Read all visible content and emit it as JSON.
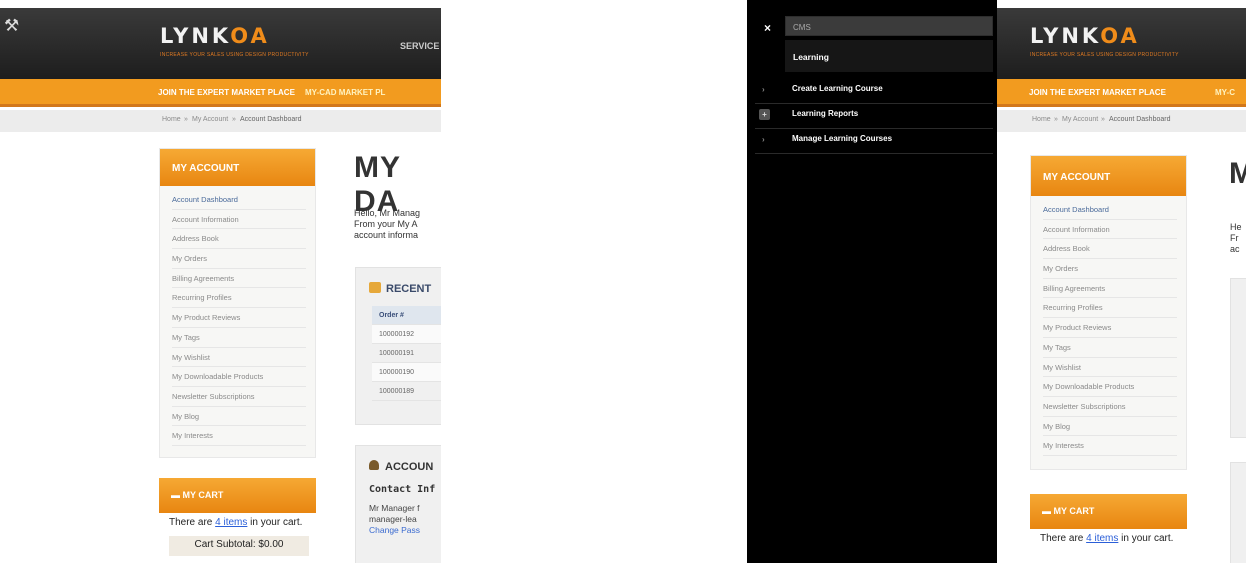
{
  "site": {
    "logo_main": "LYNK",
    "logo_accent": "OA",
    "tagline": "INCREASE YOUR SALES USING DESIGN PRODUCTIVITY",
    "topnav_item": "SERVICE",
    "orange_links": [
      "JOIN THE EXPERT MARKET PLACE",
      "MY-CAD MARKET PL"
    ],
    "orange_links_alt": [
      "JOIN THE EXPERT MARKET PLACE",
      "MY-C"
    ],
    "breadcrumb": {
      "home": "Home",
      "sep": "»",
      "account": "My Account",
      "current": "Account Dashboard"
    }
  },
  "account_nav": {
    "title": "MY ACCOUNT",
    "items": [
      "Account Dashboard",
      "Account Information",
      "Address Book",
      "My Orders",
      "Billing Agreements",
      "Recurring Profiles",
      "My Product Reviews",
      "My Tags",
      "My Wishlist",
      "My Downloadable Products",
      "Newsletter Subscriptions",
      "My Blog",
      "My Interests"
    ]
  },
  "cart": {
    "title": "MY CART",
    "text_before": "There are ",
    "link": "4 items",
    "text_after": " in your cart.",
    "subtotal": "Cart Subtotal: $0.00"
  },
  "main": {
    "title": "MY DA",
    "title_alt": "M",
    "hello_lines": [
      "Hello, Mr Manag",
      "From your My A",
      "account informa"
    ],
    "hello_lines_alt": [
      "He",
      "Fr",
      "ac"
    ],
    "recent_title": "RECENT",
    "order_header": "Order #",
    "orders": [
      "100000192",
      "100000191",
      "100000190",
      "100000189"
    ],
    "account_title": "ACCOUN",
    "contact_label": "Contact Inf",
    "contact_lines": [
      "Mr Manager f",
      "manager-lea"
    ],
    "change_password": "Change Pass"
  },
  "menu": {
    "close": "×",
    "search_value": "CMS",
    "section": "Learning",
    "items": [
      {
        "label": "Create Learning Course",
        "marker": "›"
      },
      {
        "label": "Learning Reports",
        "marker": "+"
      },
      {
        "label": "Manage Learning Courses",
        "marker": "›"
      }
    ]
  }
}
